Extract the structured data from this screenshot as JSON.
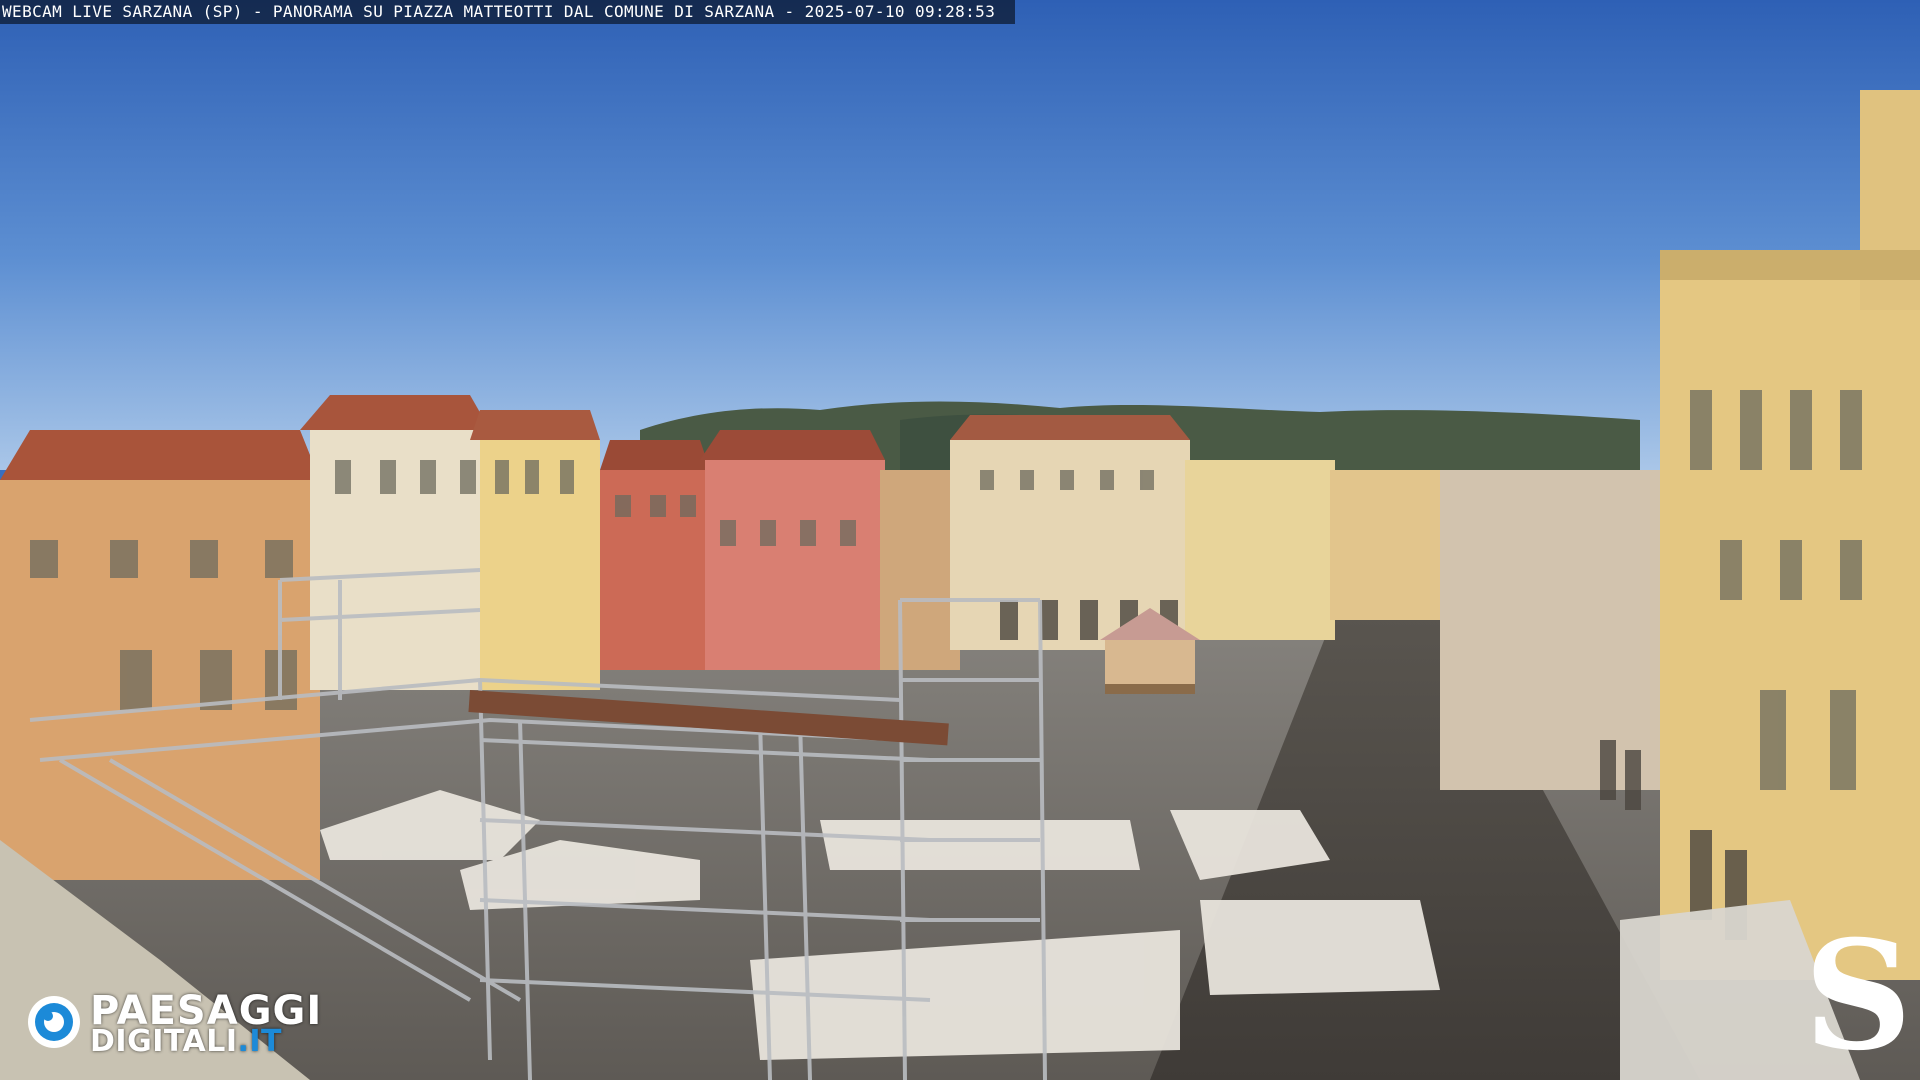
{
  "overlay": {
    "caption": "WEBCAM LIVE SARZANA (SP) - PANORAMA SU PIAZZA MATTEOTTI DAL COMUNE DI SARZANA - 2025-07-10  09:28:53"
  },
  "logos": {
    "left_line1": "PAESAGGI",
    "left_line2": "DIGITALI",
    "left_tld": ".IT",
    "right_mark": "S"
  },
  "colors": {
    "sky_top": "#2f63b8",
    "sky_bottom": "#9fc0e6",
    "accent_blue": "#1c8ad8"
  }
}
